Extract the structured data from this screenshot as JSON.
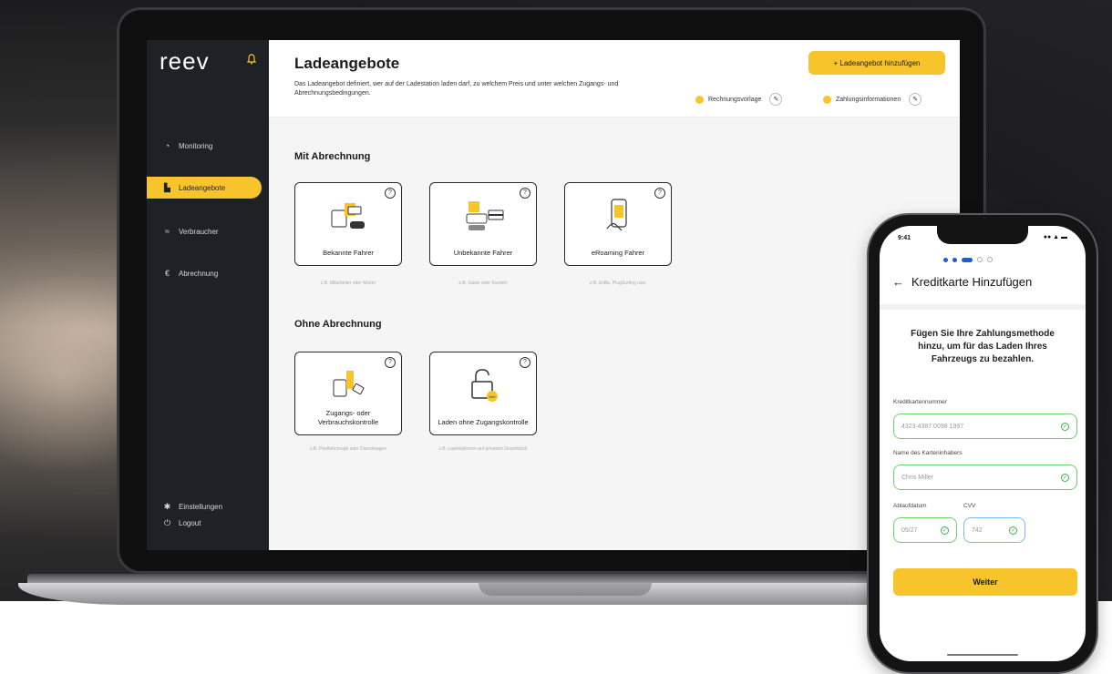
{
  "app": {
    "logo": "reev",
    "nav": [
      {
        "label": "Monitoring",
        "icon": "monitoring-icon"
      },
      {
        "label": "Ladeangebote",
        "icon": "offers-icon",
        "active": true
      },
      {
        "label": "Verbraucher",
        "icon": "consumer-icon"
      },
      {
        "label": "Abrechnung",
        "icon": "euro-icon"
      }
    ],
    "bottom_nav": [
      {
        "label": "Einstellungen",
        "icon": "settings-icon"
      },
      {
        "label": "Logout",
        "icon": "logout-icon"
      }
    ]
  },
  "header": {
    "title": "Ladeangebote",
    "description": "Das Ladeangebot definiert, wer auf der Ladestation laden darf, zu welchem Preis und unter welchen Zugangs- und Abrechnungsbedingungen.",
    "add_button": "+ Ladeangebot hinzufügen",
    "status": [
      {
        "label": "Rechnungsvorlage"
      },
      {
        "label": "Zahlungsinformationen"
      }
    ]
  },
  "sections": [
    {
      "title": "Mit Abrechnung",
      "cards": [
        {
          "label": "Bekannte Fahrer",
          "hint": "z.B. Mitarbeiter oder Mieter"
        },
        {
          "label": "Unbekannte Fahrer",
          "hint": "z.B. Gäste oder Kunden"
        },
        {
          "label": "eRoaming Fahrer",
          "hint": "z.B. EnBe, PlugSurfing usw."
        }
      ]
    },
    {
      "title": "Ohne Abrechnung",
      "cards": [
        {
          "label": "Zugangs- oder Verbrauchskontrolle",
          "hint": "z.B. Poolfahrzeuge oder Dienstwagen"
        },
        {
          "label": "Laden ohne Zugangskontrolle",
          "hint": "z.B. Ladestationen auf privatem Grundstück",
          "badge": "free"
        }
      ]
    }
  ],
  "phone": {
    "time": "9:41",
    "status_icons": "●● ▲ ▬",
    "back": "←",
    "title": "Kreditkarte Hinzufügen",
    "lead": "Fügen Sie Ihre Zahlungsmethode hinzu, um für das Laden Ihres Fahrzeugs zu bezahlen.",
    "fields": {
      "card_number": {
        "label": "Kreditkartennummer",
        "value": "4323 4387 0098 1997"
      },
      "holder": {
        "label": "Name des Karteninhabers",
        "value": "Chris Miller"
      },
      "expiry": {
        "label": "Ablaufdatum",
        "value": "05/27"
      },
      "cvv": {
        "label": "CVV",
        "value": "742"
      }
    },
    "submit": "Weiter"
  },
  "colors": {
    "accent": "#f8c42b",
    "sidebar": "#1e2126",
    "valid": "#3cb44b",
    "progress": "#1e5bd6"
  }
}
